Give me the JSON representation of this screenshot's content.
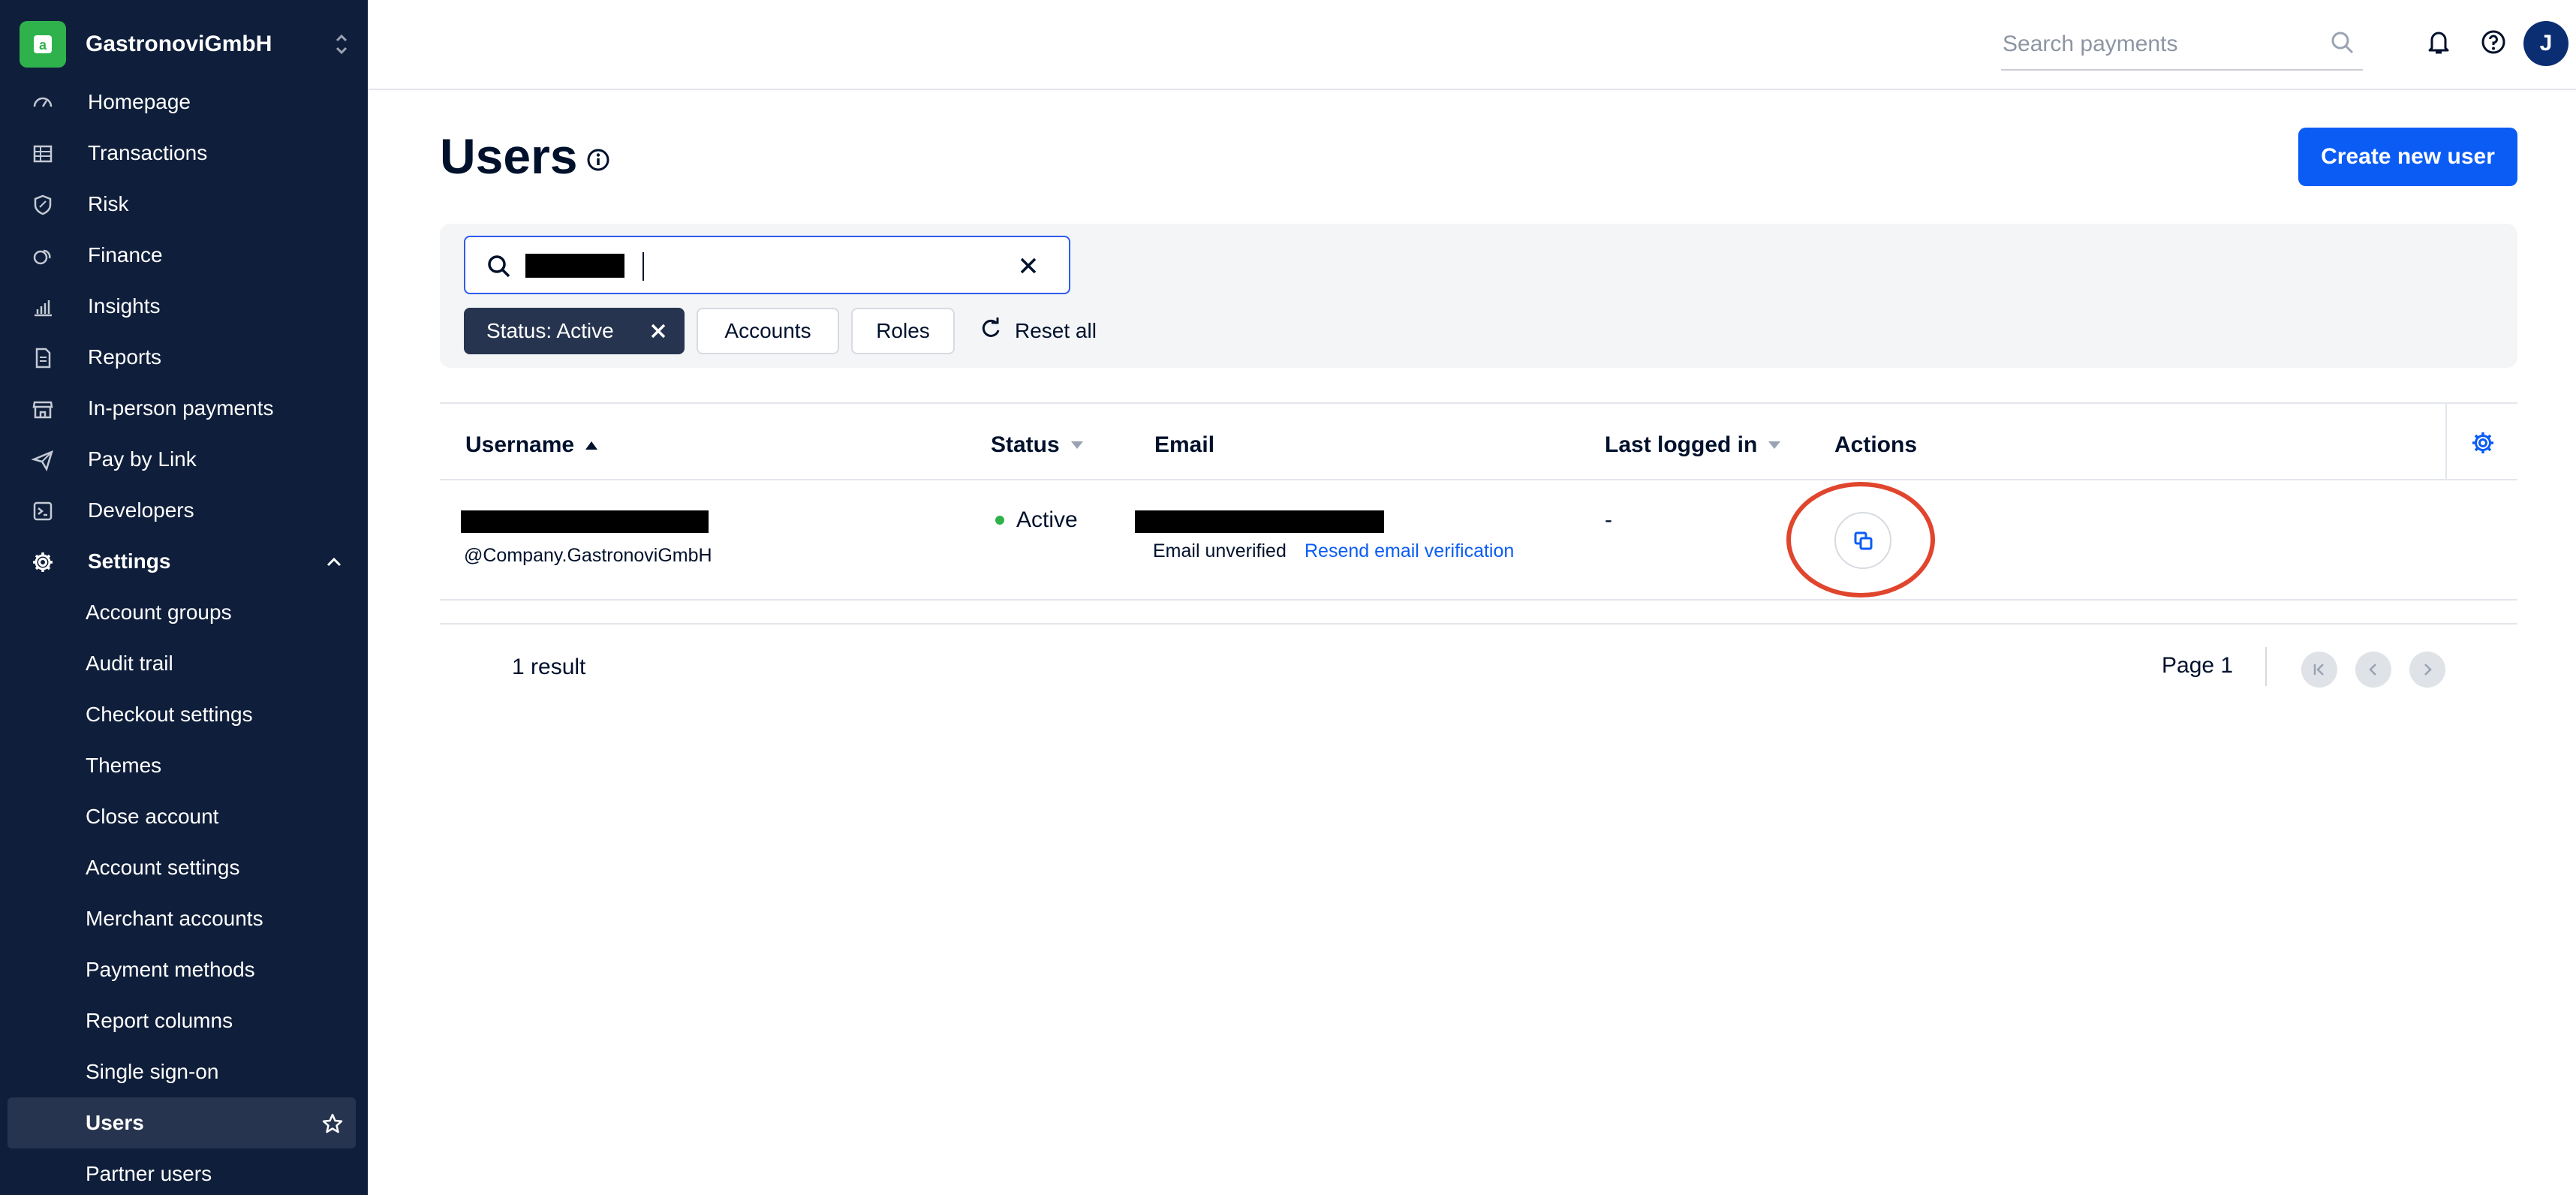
{
  "sidebar": {
    "merchant_name": "GastronoviGmbH",
    "items": [
      {
        "label": "Homepage",
        "icon": "dashboard-icon"
      },
      {
        "label": "Transactions",
        "icon": "table-icon"
      },
      {
        "label": "Risk",
        "icon": "shield-icon"
      },
      {
        "label": "Finance",
        "icon": "coins-icon"
      },
      {
        "label": "Insights",
        "icon": "bar-chart-icon"
      },
      {
        "label": "Reports",
        "icon": "document-icon"
      },
      {
        "label": "In-person payments",
        "icon": "store-icon"
      },
      {
        "label": "Pay by Link",
        "icon": "paper-plane-icon"
      },
      {
        "label": "Developers",
        "icon": "terminal-icon"
      },
      {
        "label": "Settings",
        "icon": "gear-icon"
      }
    ],
    "settings_items": [
      "Account groups",
      "Audit trail",
      "Checkout settings",
      "Themes",
      "Close account",
      "Account settings",
      "Merchant accounts",
      "Payment methods",
      "Report columns",
      "Single sign-on",
      "Users",
      "Partner users"
    ],
    "active_item": "Users"
  },
  "topbar": {
    "search_placeholder": "Search payments",
    "avatar_initial": "J"
  },
  "main": {
    "title": "Users",
    "create_button": "Create new user",
    "filters": {
      "status_chip": "Status: Active",
      "accounts": "Accounts",
      "roles": "Roles",
      "reset": "Reset all"
    },
    "columns": {
      "username": "Username",
      "status": "Status",
      "email": "Email",
      "last_logged_in": "Last logged in",
      "actions": "Actions"
    },
    "rows": [
      {
        "username_suffix": "@Company.GastronoviGmbH",
        "status": "Active",
        "email_note": "Email unverified",
        "email_link": "Resend email verification",
        "last_logged_in": "-"
      }
    ],
    "result_count": "1 result",
    "page_label": "Page 1"
  },
  "colors": {
    "sidebar_bg": "#0f1e3a",
    "accent": "#0a5cf5",
    "status_active": "#2fb24c",
    "highlight": "#e0452d"
  }
}
